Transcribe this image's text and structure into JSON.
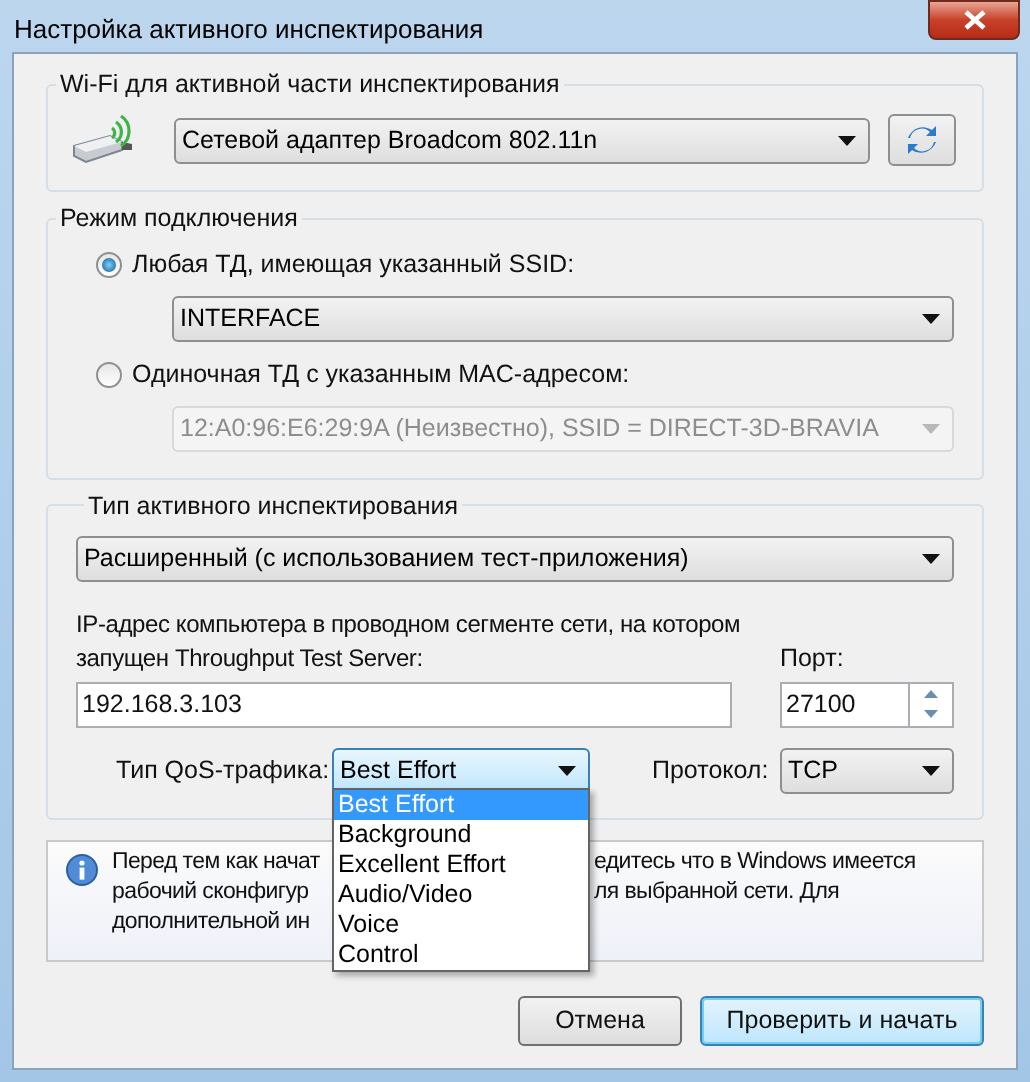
{
  "window": {
    "title": "Настройка активного инспектирования"
  },
  "wifi_group": {
    "legend": "Wi-Fi для активной части инспектирования",
    "adapter": {
      "value": "Сетевой адаптер Broadcom 802.11n"
    }
  },
  "mode_group": {
    "legend": "Режим подключения",
    "options": [
      {
        "label": "Любая ТД, имеющая указанный SSID:",
        "selected": true,
        "select": {
          "value": "INTERFACE",
          "disabled": false
        }
      },
      {
        "label": "Одиночная ТД с указанным MAC-адресом:",
        "selected": false,
        "select": {
          "value": "12:A0:96:E6:29:9A (Неизвестно), SSID = DIRECT-3D-BRAVIA",
          "disabled": true
        }
      }
    ]
  },
  "type_group": {
    "legend": "Тип активного инспектирования",
    "mode": {
      "value": "Расширенный (с использованием тест-приложения)"
    },
    "ip_label": "IP-адрес компьютера в проводном сегменте сети, на котором запущен Throughput Test Server:",
    "ip": {
      "value": "192.168.3.103"
    },
    "port_label": "Порт:",
    "port": {
      "value": "27100"
    },
    "qos_label": "Тип QoS-трафика:",
    "qos": {
      "value": "Best Effort",
      "expanded": true,
      "options": [
        {
          "label": "Best Effort",
          "selected": true
        },
        {
          "label": "Background",
          "selected": false
        },
        {
          "label": "Excellent Effort",
          "selected": false
        },
        {
          "label": "Audio/Video",
          "selected": false
        },
        {
          "label": "Voice",
          "selected": false
        },
        {
          "label": "Control",
          "selected": false
        }
      ]
    },
    "protocol_label": "Протокол:",
    "protocol": {
      "value": "TCP"
    }
  },
  "info": {
    "lines": [
      {
        "left": "Перед тем как начат",
        "right": "едитесь что в Windows имеется"
      },
      {
        "left": "рабочий сконфигур",
        "right": "ля выбранной сети. Для"
      },
      {
        "left": "дополнительной ин"
      }
    ]
  },
  "buttons": [
    {
      "label": "Отмена",
      "kind": "normal"
    },
    {
      "label": "Проверить и начать",
      "kind": "default"
    }
  ]
}
